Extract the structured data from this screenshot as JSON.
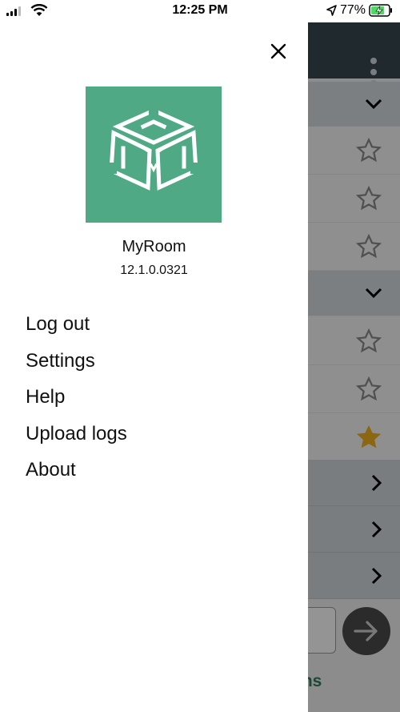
{
  "status_bar": {
    "time": "12:25 PM",
    "battery_percent": "77%",
    "battery_level": 0.77,
    "signal_icon": "signal-bars-icon",
    "wifi_icon": "wifi-icon",
    "location_icon": "location-arrow-icon",
    "battery_icon": "battery-charging-icon"
  },
  "drawer": {
    "close_icon": "close-icon",
    "logo_icon": "myroom-logo-icon",
    "app_name": "MyRoom",
    "app_version": "12.1.0.0321",
    "menu_items": [
      {
        "label": "Log out"
      },
      {
        "label": "Settings"
      },
      {
        "label": "Help"
      },
      {
        "label": "Upload logs"
      },
      {
        "label": "About"
      }
    ]
  },
  "background": {
    "partial_link_text": "ms",
    "icons": [
      "more-vert-icon",
      "chevron-down-icon",
      "star-outline-icon",
      "star-filled-icon",
      "chevron-right-icon",
      "arrow-right-icon"
    ]
  },
  "colors": {
    "accent_green": "#4fa985",
    "header_dark": "#37474f",
    "star_filled": "#f2b01e",
    "battery_green": "#4cd964"
  }
}
